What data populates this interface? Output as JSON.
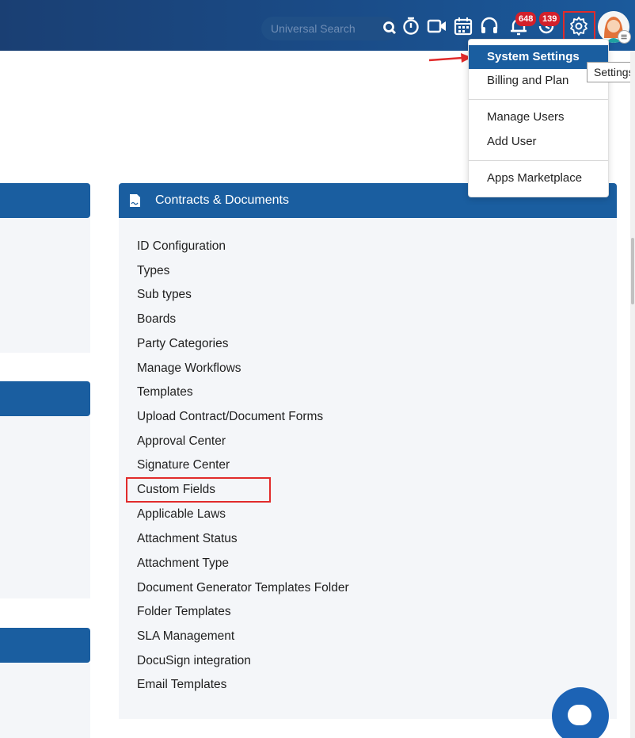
{
  "header": {
    "search_placeholder": "Universal Search",
    "notifications_badge": "648",
    "reminders_badge": "139"
  },
  "settings_menu": {
    "items": [
      {
        "label": "System Settings",
        "active": true
      },
      {
        "label": "Billing and Plan"
      },
      {
        "label": "Manage Users"
      },
      {
        "label": "Add User"
      },
      {
        "label": "Apps Marketplace"
      }
    ],
    "tooltip": "Settings"
  },
  "contracts_card": {
    "title": "Contracts & Documents",
    "items": [
      "ID Configuration",
      "Types",
      "Sub types",
      "Boards",
      "Party Categories",
      "Manage Workflows",
      "Templates",
      "Upload Contract/Document Forms",
      "Approval Center",
      "Signature Center",
      "Custom Fields",
      "Applicable Laws",
      "Attachment Status",
      "Attachment Type",
      "Document Generator Templates Folder",
      "Folder Templates",
      "SLA Management",
      "DocuSign integration",
      "Email Templates"
    ]
  },
  "colors": {
    "header_bg": "#1a4c88",
    "card_header": "#1a5ea0",
    "highlight": "#e12b2b",
    "badge": "#d3202b"
  }
}
